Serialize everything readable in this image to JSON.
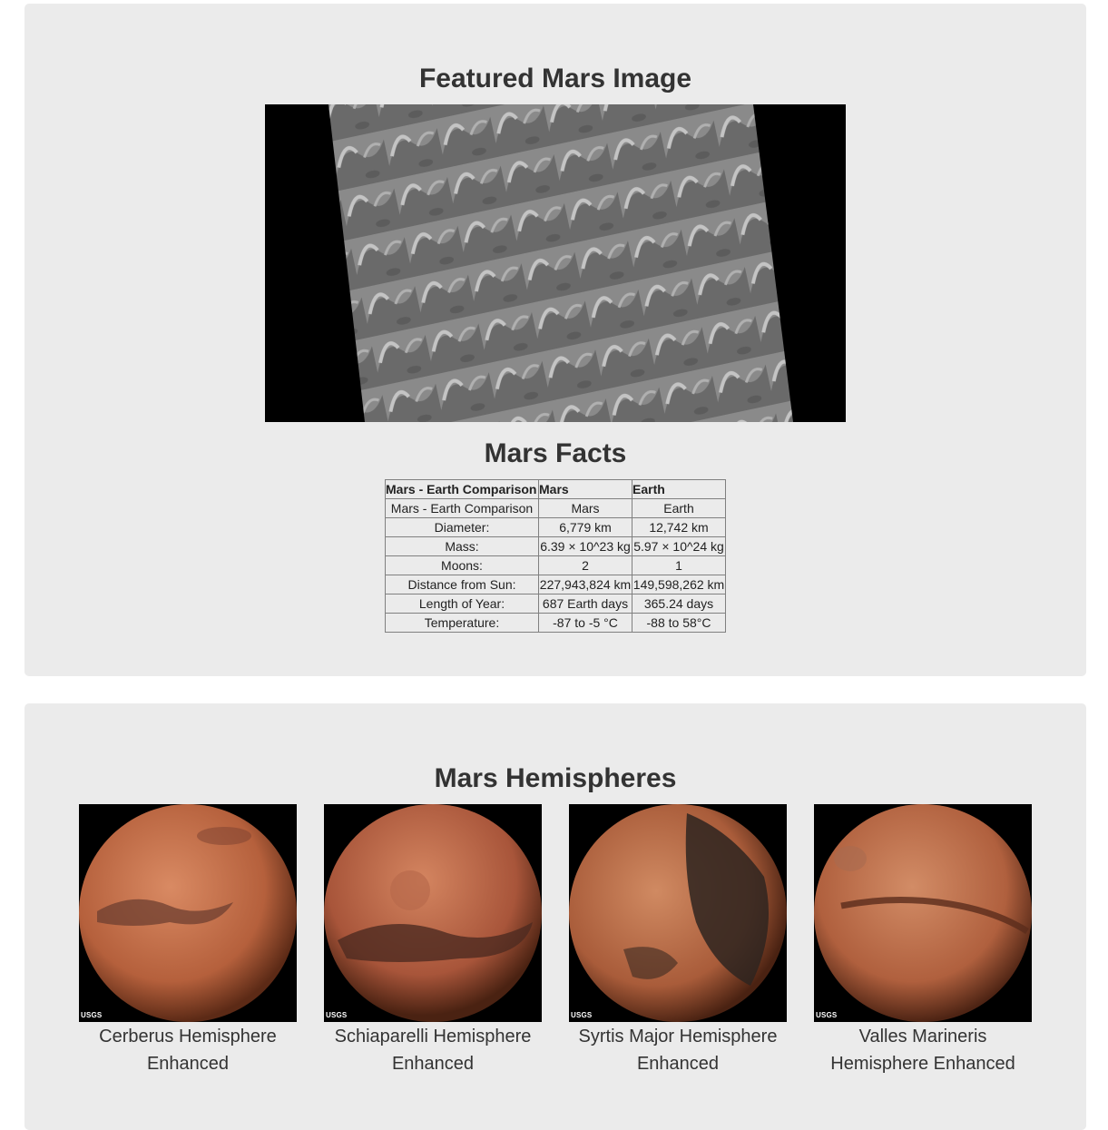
{
  "featured": {
    "title": "Featured Mars Image"
  },
  "facts": {
    "title": "Mars Facts",
    "header": [
      "Mars - Earth Comparison",
      "Mars",
      "Earth"
    ],
    "rows": [
      [
        "Mars - Earth Comparison",
        "Mars",
        "Earth"
      ],
      [
        "Diameter:",
        "6,779 km",
        "12,742 km"
      ],
      [
        "Mass:",
        "6.39 × 10^23 kg",
        "5.97 × 10^24 kg"
      ],
      [
        "Moons:",
        "2",
        "1"
      ],
      [
        "Distance from Sun:",
        "227,943,824 km",
        "149,598,262 km"
      ],
      [
        "Length of Year:",
        "687 Earth days",
        "365.24 days"
      ],
      [
        "Temperature:",
        "-87 to -5 °C",
        "-88 to 58°C"
      ]
    ]
  },
  "hemispheres": {
    "title": "Mars Hemispheres",
    "items": [
      {
        "title": "Cerberus Hemisphere Enhanced",
        "logo": "USGS"
      },
      {
        "title": "Schiaparelli Hemisphere Enhanced",
        "logo": "USGS"
      },
      {
        "title": "Syrtis Major Hemisphere Enhanced",
        "logo": "USGS"
      },
      {
        "title": "Valles Marineris Hemisphere Enhanced",
        "logo": "USGS"
      }
    ]
  },
  "colors": {
    "panel_bg": "#ebebeb",
    "text": "#333333",
    "mars_base": "#b5603c"
  }
}
